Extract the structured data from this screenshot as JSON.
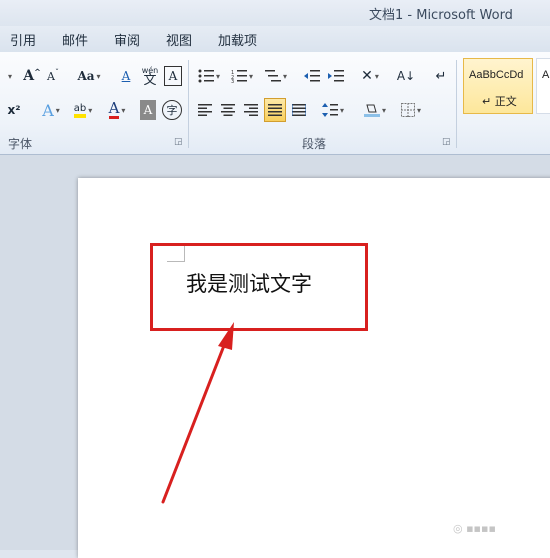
{
  "window": {
    "title": "文档1  -  Microsoft Word"
  },
  "tabs": [
    "引用",
    "邮件",
    "审阅",
    "视图",
    "加载项"
  ],
  "ribbon": {
    "font_group": {
      "label": "字体",
      "grow_font": "A",
      "shrink_font": "A",
      "change_case": "Aa",
      "clear_format": "A",
      "phonetic": "wén",
      "phonetic_char": "文",
      "char_border": "A",
      "superscript": "x²",
      "text_effects": "A",
      "highlight": "ab",
      "font_color": "A",
      "char_shading": "A",
      "enclose_char": "字"
    },
    "paragraph_group": {
      "label": "段落"
    },
    "styles": {
      "normal_sample": "AaBbCcDd",
      "normal_name": "↵ 正文",
      "next_sample": "A"
    }
  },
  "document": {
    "text": "我是测试文字"
  },
  "annotation": {
    "color": "#d8201f"
  },
  "icons": [
    "grow-font-icon",
    "shrink-font-icon",
    "change-case-icon",
    "clear-format-icon",
    "phonetic-guide-icon",
    "char-border-icon",
    "superscript-icon",
    "text-effects-icon",
    "highlight-icon",
    "font-color-icon",
    "char-shading-icon",
    "enclose-char-icon",
    "bullets-icon",
    "numbering-icon",
    "multilevel-list-icon",
    "decrease-indent-icon",
    "increase-indent-icon",
    "chinese-layout-icon",
    "sort-icon",
    "show-marks-icon",
    "align-left-icon",
    "align-center-icon",
    "align-right-icon",
    "justify-icon",
    "distributed-icon",
    "line-spacing-icon",
    "shading-icon",
    "borders-icon"
  ]
}
